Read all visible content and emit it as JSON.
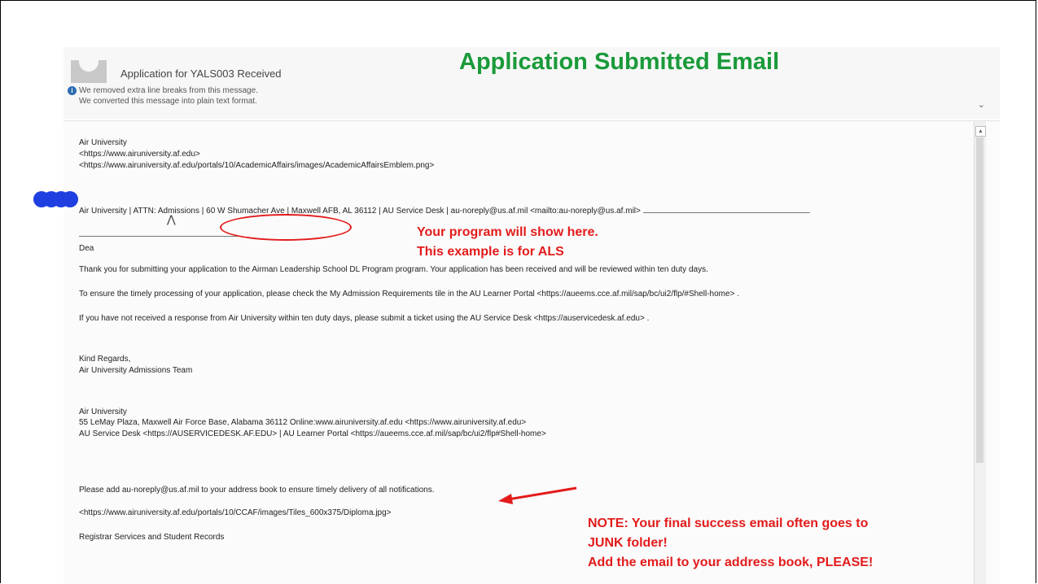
{
  "slide": {
    "title": "Application Submitted Email"
  },
  "email": {
    "subject": "Application for YALS003 Received",
    "info_lines": [
      "We removed extra line breaks from this message.",
      "We converted this message into plain text format."
    ],
    "lines": [
      "Air University",
      "<https://www.airuniversity.af.edu>",
      " <https://www.airuniversity.af.edu/portals/10/AcademicAffairs/images/AcademicAffairsEmblem.png>",
      "Air University | ATTN: Admissions | 60 W Shumacher Ave | Maxwell AFB, AL 36112 | AU Service Desk | au-noreply@us.af.mil <mailto:au-noreply@us.af.mil> ",
      "Dea",
      "Thank you for submitting your application to the Airman Leadership School DL Program program. Your application has been received and will be reviewed within ten duty days.",
      "To ensure the timely processing of your application, please check the My Admission Requirements tile in the AU Learner Portal <https://aueems.cce.af.mil/sap/bc/ui2/flp/#Shell-home> .",
      "If you have not received a response from Air University within ten duty days, please submit a ticket using the AU Service Desk <https://auservicedesk.af.edu> .",
      "Kind Regards,",
      "Air University Admissions Team",
      "Air University",
      "55 LeMay Plaza, Maxwell Air Force Base, Alabama 36112 Online:www.airuniversity.af.edu <https://www.airuniversity.af.edu>",
      "AU Service Desk <https://AUSERVICEDESK.AF.EDU> | AU Learner Portal <https://aueems.cce.af.mil/sap/bc/ui2/flp#Shell-home>",
      "Please add au-noreply@us.af.mil to your address book to ensure timely delivery of all notifications.",
      " <https://www.airuniversity.af.edu/portals/10/CCAF/images/Tiles_600x375/Diploma.jpg>",
      "Registrar Services and Student Records"
    ]
  },
  "annotations": {
    "program": [
      "Your program will show here.",
      "This example is for ALS"
    ],
    "note": [
      "NOTE:  Your final success email often goes to",
      "JUNK folder!",
      "Add the email to your address book, PLEASE!"
    ]
  },
  "colors": {
    "title_green": "#1a9a3a",
    "annotation_red": "#e31b1b",
    "redaction_blue": "#1f3fe0"
  },
  "icons": {
    "info": "info-icon",
    "expand": "chevron-down-icon",
    "scroll_up": "scroll-up-arrow-icon"
  }
}
